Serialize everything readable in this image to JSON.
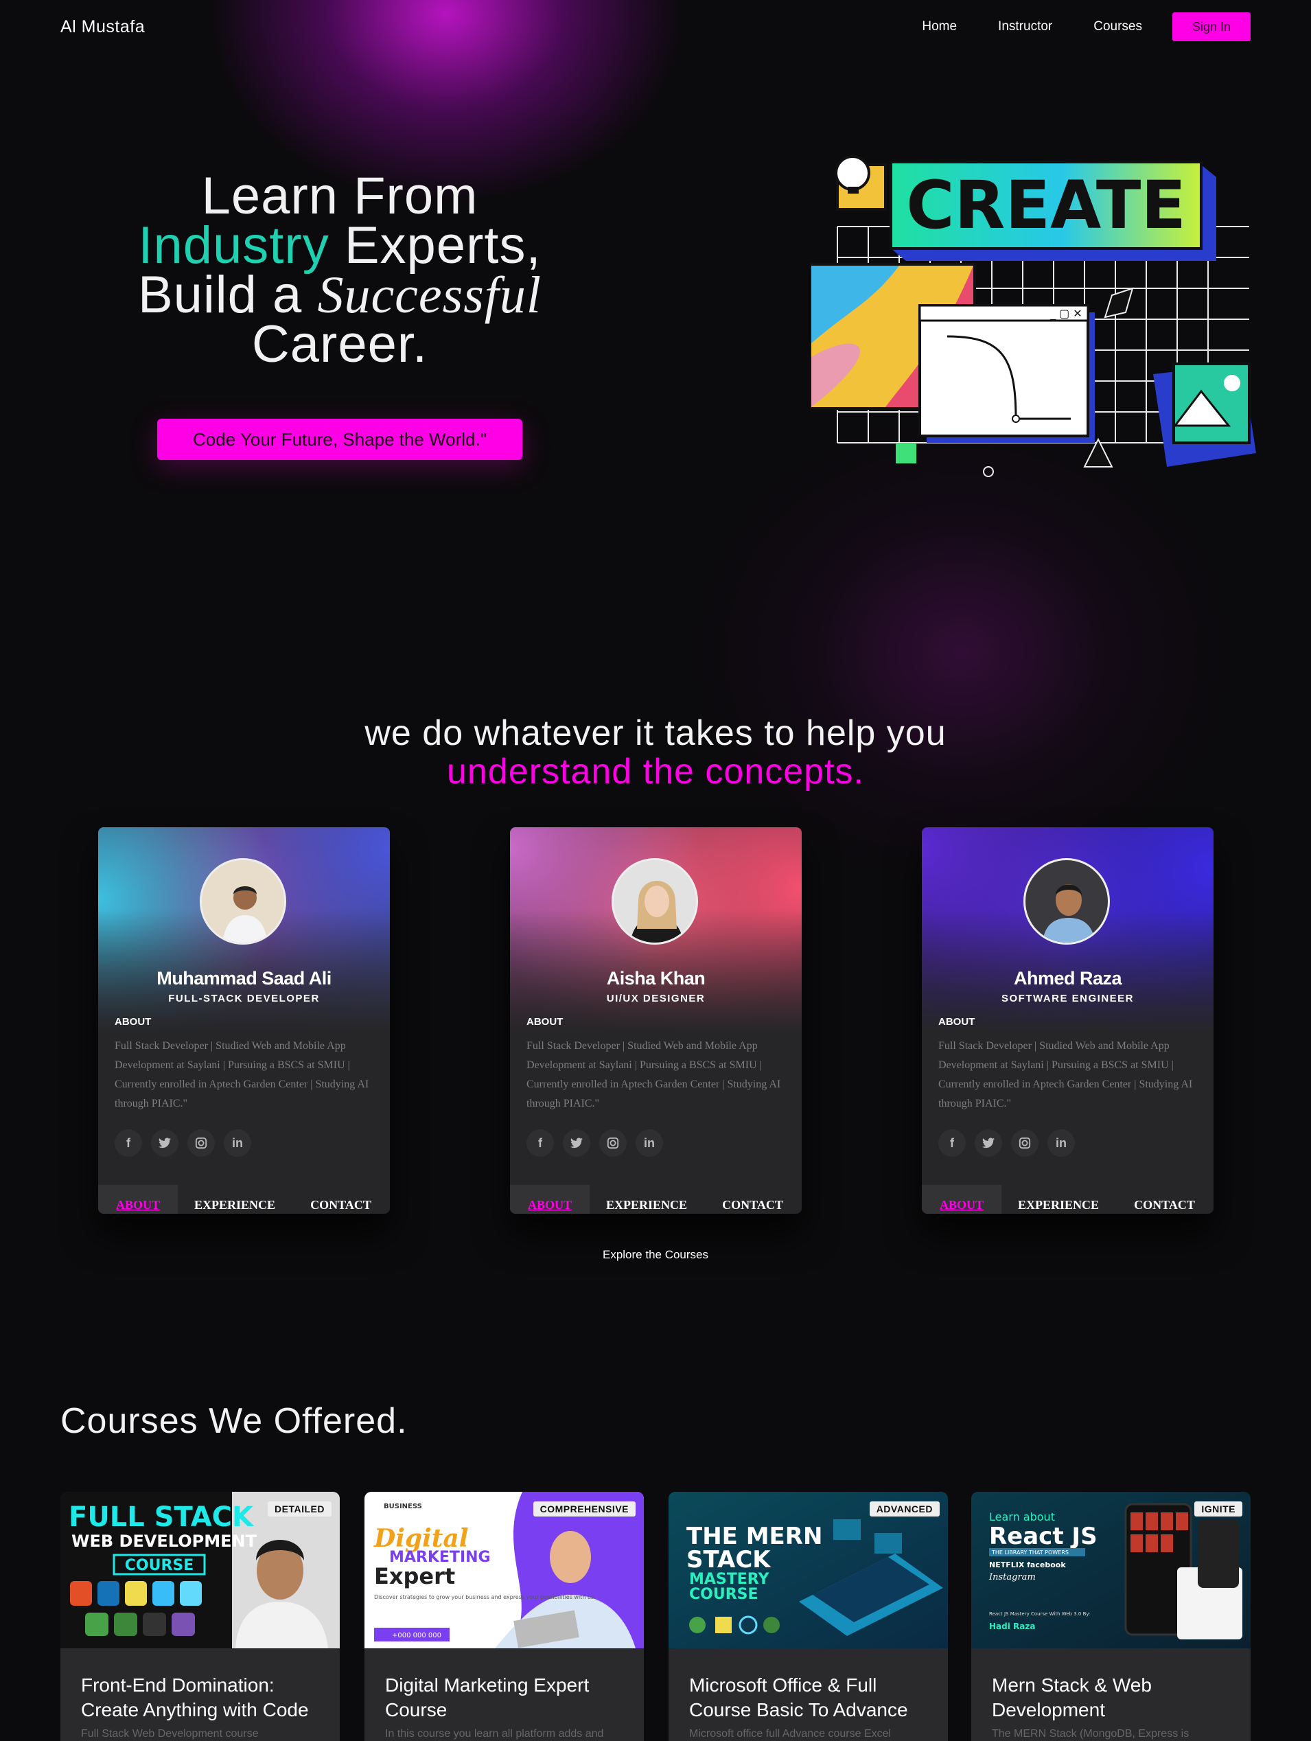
{
  "nav": {
    "brand": "Al Mustafa",
    "links": [
      "Home",
      "Instructor",
      "Courses"
    ],
    "signin": "Sign In"
  },
  "hero": {
    "line1": "Learn From",
    "line2_accent": "Industry",
    "line2_rest": "Experts,",
    "line3_start": "Build a",
    "line3_serif": "Successful",
    "line4": "Career.",
    "cta": "Code Your Future, Shape the World.\"",
    "art_word": "CREATE"
  },
  "section2": {
    "line1": "we do whatever it takes to help you",
    "line2": "understand the concepts."
  },
  "team": [
    {
      "name": "Muhammad Saad Ali",
      "role": "FULL-STACK DEVELOPER",
      "about_heading": "ABOUT",
      "about": "Full Stack Developer | Studied Web and Mobile App Development at Saylani | Pursuing a BSCS at SMIU | Currently enrolled in Aptech Garden Center | Studying AI through PIAIC.\"",
      "tabs": [
        "ABOUT",
        "EXPERIENCE",
        "CONTACT"
      ]
    },
    {
      "name": "Aisha Khan",
      "role": "UI/UX DESIGNER",
      "about_heading": "ABOUT",
      "about": "Full Stack Developer | Studied Web and Mobile App Development at Saylani | Pursuing a BSCS at SMIU | Currently enrolled in Aptech Garden Center | Studying AI through PIAIC.\"",
      "tabs": [
        "ABOUT",
        "EXPERIENCE",
        "CONTACT"
      ]
    },
    {
      "name": "Ahmed Raza",
      "role": "SOFTWARE ENGINEER",
      "about_heading": "ABOUT",
      "about": "Full Stack Developer | Studied Web and Mobile App Development at Saylani | Pursuing a BSCS at SMIU | Currently enrolled in Aptech Garden Center | Studying AI through PIAIC.\"",
      "tabs": [
        "ABOUT",
        "EXPERIENCE",
        "CONTACT"
      ]
    }
  ],
  "socials": [
    "facebook-icon",
    "twitter-icon",
    "instagram-icon",
    "linkedin-icon"
  ],
  "explore": "Explore the Courses",
  "courses_heading": "Courses We Offered.",
  "courses": [
    {
      "badge": "DETAILED",
      "title": "Front-End Domination: Create Anything with Code",
      "desc": "Full Stack Web Development course",
      "thumb": {
        "l1": "FULL STACK",
        "l2": "WEB DEVELOPMENT",
        "l3": "COURSE"
      }
    },
    {
      "badge": "COMPREHENSIVE",
      "title": "Digital Marketing Expert Course",
      "desc": "In this course you learn all platform adds and",
      "thumb": {
        "l1": "Digital",
        "l2": "MARKETING",
        "l3": "Expert",
        "small": "Discover strategies to grow your business and express your possibilities with us.",
        "phone": "+000 000 000",
        "logo": "BUSINESS"
      }
    },
    {
      "badge": "ADVANCED",
      "title": "Microsoft Office & Full Course Basic To Advance",
      "desc": "Microsoft office full Advance course Excel",
      "thumb": {
        "l1": "THE MERN",
        "l2": "STACK",
        "l3": "MASTERY",
        "l4": "COURSE"
      }
    },
    {
      "badge": "IGNITE",
      "title": "Mern Stack & Web Development",
      "desc": "The MERN Stack (MongoDB, Express is",
      "thumb": {
        "l1": "Learn about",
        "l2": "React JS",
        "l3": "THE LIBRARY THAT POWERS",
        "l4": "NETFLIX facebook",
        "l5": "Instagram",
        "l6": "React JS Mastery Course With Web 3.0 By:",
        "l7": "Hadi Raza"
      }
    }
  ]
}
